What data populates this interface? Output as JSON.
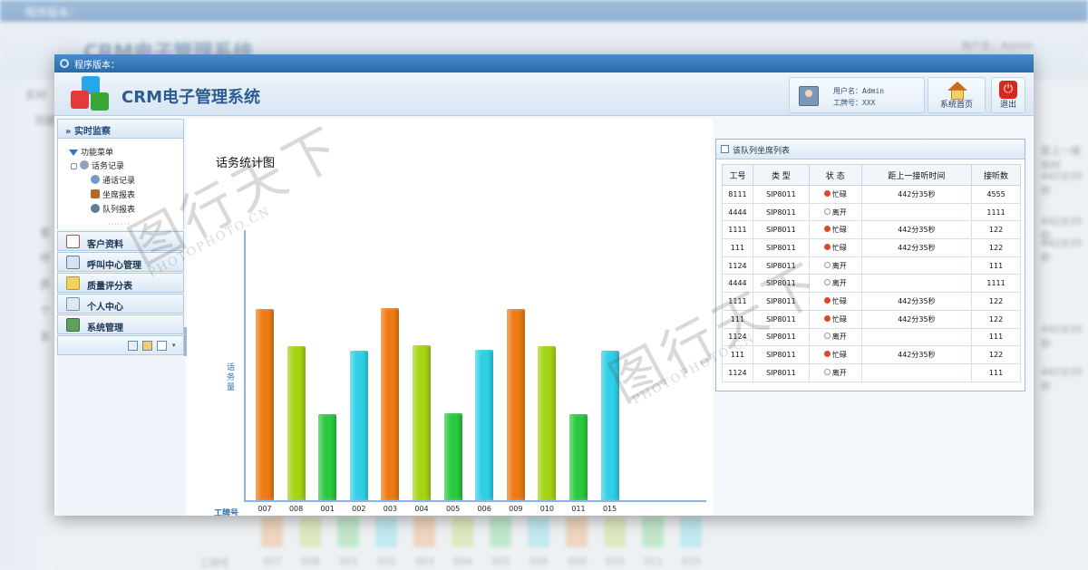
{
  "window": {
    "title": "程序版本：",
    "app_title": "CRM电子管理系统"
  },
  "header": {
    "user_line": "用户名：Admin",
    "id_line": "工牌号：XXX",
    "home_label": "系统首页",
    "logout_label": "退出"
  },
  "sidebar": {
    "section_title": "实时监察",
    "tree": {
      "root": "功能菜单",
      "group": "话务记录",
      "items": [
        "通话记录",
        "坐席报表",
        "队列报表"
      ]
    },
    "nav": [
      "客户资料",
      "呼叫中心管理",
      "质量评分表",
      "个人中心",
      "系统管理"
    ]
  },
  "chart": {
    "title": "话务统计图",
    "ylabel": "话务量",
    "xlabel": "工牌号"
  },
  "chart_data": {
    "type": "bar",
    "title": "话务统计图",
    "xlabel": "工牌号",
    "ylabel": "话务量",
    "categories": [
      "007",
      "008",
      "001",
      "002",
      "003",
      "004",
      "005",
      "006",
      "009",
      "010",
      "011",
      "015"
    ],
    "values": [
      211,
      170,
      95,
      165,
      212,
      171,
      96,
      166,
      211,
      170,
      95,
      165
    ],
    "colors": [
      "#ee7a14",
      "#a4d412",
      "#29c93e",
      "#2fcfe6",
      "#ee7a14",
      "#a4d412",
      "#29c93e",
      "#2fcfe6",
      "#ee7a14",
      "#a4d412",
      "#29c93e",
      "#2fcfe6"
    ],
    "ylim": [
      0,
      300
    ]
  },
  "queue": {
    "title": "该队列坐席列表",
    "columns": [
      "工号",
      "类 型",
      "状 态",
      "距上一接听时间",
      "接听数"
    ],
    "rows": [
      [
        "8111",
        "SIP8011",
        "忙碌",
        "442分35秒",
        "4555"
      ],
      [
        "4444",
        "SIP8011",
        "离开",
        "",
        "1111"
      ],
      [
        "1111",
        "SIP8011",
        "忙碌",
        "442分35秒",
        "122"
      ],
      [
        "111",
        "SIP8011",
        "忙碌",
        "442分35秒",
        "122"
      ],
      [
        "1124",
        "SIP8011",
        "离开",
        "",
        "111"
      ],
      [
        "4444",
        "SIP8011",
        "离开",
        "",
        "1111"
      ],
      [
        "1111",
        "SIP8011",
        "忙碌",
        "442分35秒",
        "122"
      ],
      [
        "111",
        "SIP8011",
        "忙碌",
        "442分35秒",
        "122"
      ],
      [
        "1124",
        "SIP8011",
        "离开",
        "",
        "111"
      ],
      [
        "111",
        "SIP8011",
        "忙碌",
        "442分35秒",
        "122"
      ],
      [
        "1124",
        "SIP8011",
        "离开",
        "",
        "111"
      ]
    ]
  },
  "background": {
    "title": "程序版本：",
    "app_title": "CRM电子管理系统",
    "user_line": "用户名：Admin",
    "side_labels": [
      "实时",
      "功能",
      "客",
      "呼",
      "质",
      "个",
      "系"
    ],
    "right_notes": [
      "距上一接听时",
      "442分35秒",
      "442分35秒",
      "442分35秒",
      "442分35秒",
      "442分35秒"
    ],
    "footer_xlabel": "工牌号",
    "footer_ticks": [
      "007",
      "008",
      "001",
      "002",
      "003",
      "004",
      "005",
      "006",
      "009",
      "010",
      "011",
      "015"
    ]
  },
  "watermark": {
    "text": "图行天下",
    "sub": "PHOTOPHOTO.CN"
  },
  "colors": {
    "titlebar": "#2a6aaa",
    "accent": "#2d5c92",
    "busy": "#e0462c"
  }
}
